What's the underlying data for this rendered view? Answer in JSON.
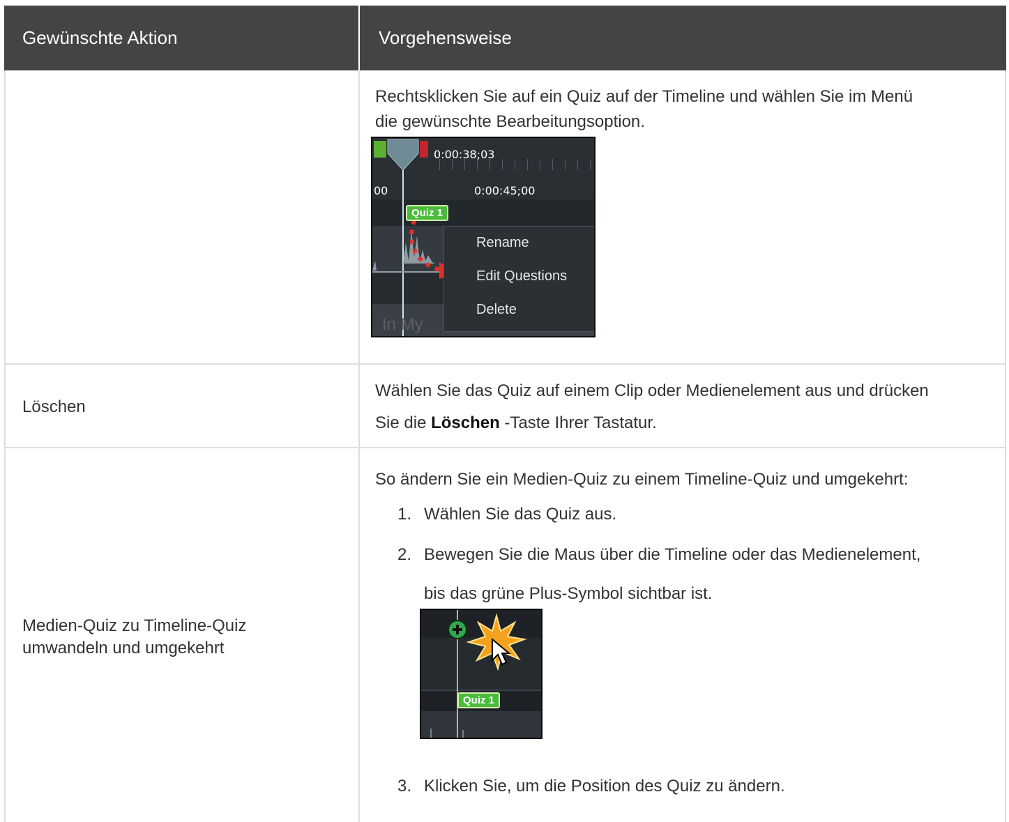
{
  "header": {
    "col_action": "Gewünschte Aktion",
    "col_procedure": "Vorgehensweise"
  },
  "rows": [
    {
      "action": "",
      "procedure": {
        "text": "Rechtsklicken Sie auf ein Quiz auf der Timeline und wählen Sie im Menü die gewünschte Bearbeitungsoption.",
        "line1": "Rechtsklicken Sie auf ein Quiz auf der Timeline und wählen Sie im Menü",
        "line2": "die gewünschte Bearbeitungsoption."
      },
      "screenshot": {
        "playhead_time": "0:00:38;03",
        "ruler_left": "00",
        "ruler_time": "0:00:45;00",
        "quiz_marker": "Quiz 1",
        "context_menu": [
          "Rename",
          "Edit Questions",
          "Delete"
        ],
        "track_text": "In My"
      }
    },
    {
      "action": "Löschen",
      "procedure": {
        "line1": "Wählen Sie das Quiz auf einem Clip oder Medienelement aus und drücken",
        "line2_prefix": "Sie die ",
        "line2_key": "Löschen",
        "line2_suffix": " -Taste Ihrer Tastatur."
      }
    },
    {
      "action_line1": "Medien-Quiz zu Timeline-Quiz",
      "action_line2": "umwandeln und umgekehrt",
      "procedure": {
        "intro": "So ändern Sie ein Medien-Quiz zu einem Timeline-Quiz und umgekehrt:",
        "steps": [
          {
            "num": "1.",
            "text": "Wählen Sie das Quiz aus."
          },
          {
            "num": "2.",
            "text_line1": "Bewegen Sie die Maus über die Timeline oder das Medienelement,",
            "text_line2": "bis das grüne Plus-Symbol sichtbar ist."
          },
          {
            "num": "3.",
            "text": "Klicken Sie, um die Position des Quiz zu ändern."
          }
        ]
      },
      "screenshot": {
        "quiz_marker": "Quiz 1"
      }
    }
  ],
  "colors": {
    "header_bg": "#444444",
    "border": "#dddddd",
    "quiz_green": "#4cbb3d",
    "playhead_blue": "#6f8a95",
    "arrow_red": "#e0322c"
  }
}
